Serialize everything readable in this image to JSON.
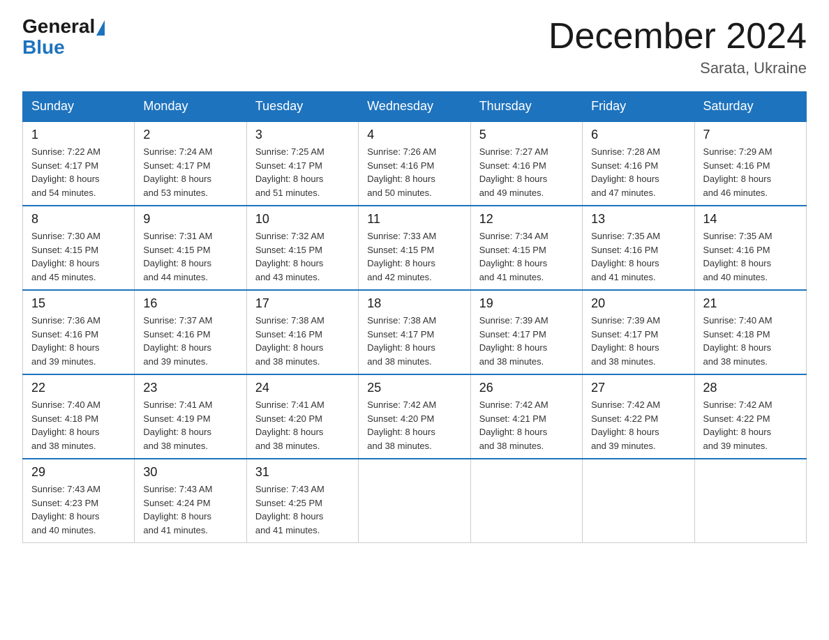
{
  "logo": {
    "general": "General",
    "blue": "Blue"
  },
  "title": "December 2024",
  "location": "Sarata, Ukraine",
  "days_of_week": [
    "Sunday",
    "Monday",
    "Tuesday",
    "Wednesday",
    "Thursday",
    "Friday",
    "Saturday"
  ],
  "weeks": [
    [
      {
        "day": "1",
        "sunrise": "7:22 AM",
        "sunset": "4:17 PM",
        "daylight": "8 hours and 54 minutes."
      },
      {
        "day": "2",
        "sunrise": "7:24 AM",
        "sunset": "4:17 PM",
        "daylight": "8 hours and 53 minutes."
      },
      {
        "day": "3",
        "sunrise": "7:25 AM",
        "sunset": "4:17 PM",
        "daylight": "8 hours and 51 minutes."
      },
      {
        "day": "4",
        "sunrise": "7:26 AM",
        "sunset": "4:16 PM",
        "daylight": "8 hours and 50 minutes."
      },
      {
        "day": "5",
        "sunrise": "7:27 AM",
        "sunset": "4:16 PM",
        "daylight": "8 hours and 49 minutes."
      },
      {
        "day": "6",
        "sunrise": "7:28 AM",
        "sunset": "4:16 PM",
        "daylight": "8 hours and 47 minutes."
      },
      {
        "day": "7",
        "sunrise": "7:29 AM",
        "sunset": "4:16 PM",
        "daylight": "8 hours and 46 minutes."
      }
    ],
    [
      {
        "day": "8",
        "sunrise": "7:30 AM",
        "sunset": "4:15 PM",
        "daylight": "8 hours and 45 minutes."
      },
      {
        "day": "9",
        "sunrise": "7:31 AM",
        "sunset": "4:15 PM",
        "daylight": "8 hours and 44 minutes."
      },
      {
        "day": "10",
        "sunrise": "7:32 AM",
        "sunset": "4:15 PM",
        "daylight": "8 hours and 43 minutes."
      },
      {
        "day": "11",
        "sunrise": "7:33 AM",
        "sunset": "4:15 PM",
        "daylight": "8 hours and 42 minutes."
      },
      {
        "day": "12",
        "sunrise": "7:34 AM",
        "sunset": "4:15 PM",
        "daylight": "8 hours and 41 minutes."
      },
      {
        "day": "13",
        "sunrise": "7:35 AM",
        "sunset": "4:16 PM",
        "daylight": "8 hours and 41 minutes."
      },
      {
        "day": "14",
        "sunrise": "7:35 AM",
        "sunset": "4:16 PM",
        "daylight": "8 hours and 40 minutes."
      }
    ],
    [
      {
        "day": "15",
        "sunrise": "7:36 AM",
        "sunset": "4:16 PM",
        "daylight": "8 hours and 39 minutes."
      },
      {
        "day": "16",
        "sunrise": "7:37 AM",
        "sunset": "4:16 PM",
        "daylight": "8 hours and 39 minutes."
      },
      {
        "day": "17",
        "sunrise": "7:38 AM",
        "sunset": "4:16 PM",
        "daylight": "8 hours and 38 minutes."
      },
      {
        "day": "18",
        "sunrise": "7:38 AM",
        "sunset": "4:17 PM",
        "daylight": "8 hours and 38 minutes."
      },
      {
        "day": "19",
        "sunrise": "7:39 AM",
        "sunset": "4:17 PM",
        "daylight": "8 hours and 38 minutes."
      },
      {
        "day": "20",
        "sunrise": "7:39 AM",
        "sunset": "4:17 PM",
        "daylight": "8 hours and 38 minutes."
      },
      {
        "day": "21",
        "sunrise": "7:40 AM",
        "sunset": "4:18 PM",
        "daylight": "8 hours and 38 minutes."
      }
    ],
    [
      {
        "day": "22",
        "sunrise": "7:40 AM",
        "sunset": "4:18 PM",
        "daylight": "8 hours and 38 minutes."
      },
      {
        "day": "23",
        "sunrise": "7:41 AM",
        "sunset": "4:19 PM",
        "daylight": "8 hours and 38 minutes."
      },
      {
        "day": "24",
        "sunrise": "7:41 AM",
        "sunset": "4:20 PM",
        "daylight": "8 hours and 38 minutes."
      },
      {
        "day": "25",
        "sunrise": "7:42 AM",
        "sunset": "4:20 PM",
        "daylight": "8 hours and 38 minutes."
      },
      {
        "day": "26",
        "sunrise": "7:42 AM",
        "sunset": "4:21 PM",
        "daylight": "8 hours and 38 minutes."
      },
      {
        "day": "27",
        "sunrise": "7:42 AM",
        "sunset": "4:22 PM",
        "daylight": "8 hours and 39 minutes."
      },
      {
        "day": "28",
        "sunrise": "7:42 AM",
        "sunset": "4:22 PM",
        "daylight": "8 hours and 39 minutes."
      }
    ],
    [
      {
        "day": "29",
        "sunrise": "7:43 AM",
        "sunset": "4:23 PM",
        "daylight": "8 hours and 40 minutes."
      },
      {
        "day": "30",
        "sunrise": "7:43 AM",
        "sunset": "4:24 PM",
        "daylight": "8 hours and 41 minutes."
      },
      {
        "day": "31",
        "sunrise": "7:43 AM",
        "sunset": "4:25 PM",
        "daylight": "8 hours and 41 minutes."
      },
      null,
      null,
      null,
      null
    ]
  ],
  "labels": {
    "sunrise": "Sunrise:",
    "sunset": "Sunset:",
    "daylight": "Daylight:"
  }
}
